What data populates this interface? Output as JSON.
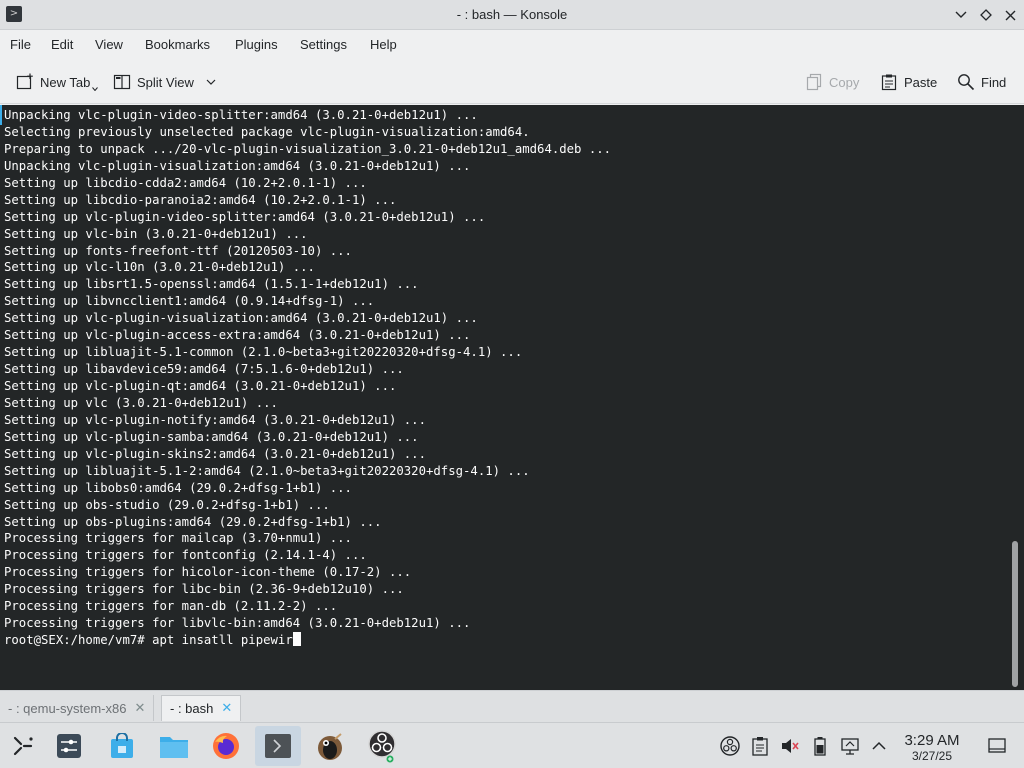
{
  "window": {
    "title": "- : bash — Konsole"
  },
  "menu": {
    "items": [
      "File",
      "Edit",
      "View",
      "Bookmarks",
      "Plugins",
      "Settings",
      "Help"
    ]
  },
  "toolbar": {
    "new_tab": "New Tab",
    "split_view": "Split View",
    "copy": "Copy",
    "paste": "Paste",
    "find": "Find"
  },
  "terminal": {
    "lines": [
      "Unpacking vlc-plugin-video-splitter:amd64 (3.0.21-0+deb12u1) ...",
      "Selecting previously unselected package vlc-plugin-visualization:amd64.",
      "Preparing to unpack .../20-vlc-plugin-visualization_3.0.21-0+deb12u1_amd64.deb ...",
      "Unpacking vlc-plugin-visualization:amd64 (3.0.21-0+deb12u1) ...",
      "Setting up libcdio-cdda2:amd64 (10.2+2.0.1-1) ...",
      "Setting up libcdio-paranoia2:amd64 (10.2+2.0.1-1) ...",
      "Setting up vlc-plugin-video-splitter:amd64 (3.0.21-0+deb12u1) ...",
      "Setting up vlc-bin (3.0.21-0+deb12u1) ...",
      "Setting up fonts-freefont-ttf (20120503-10) ...",
      "Setting up vlc-l10n (3.0.21-0+deb12u1) ...",
      "Setting up libsrt1.5-openssl:amd64 (1.5.1-1+deb12u1) ...",
      "Setting up libvncclient1:amd64 (0.9.14+dfsg-1) ...",
      "Setting up vlc-plugin-visualization:amd64 (3.0.21-0+deb12u1) ...",
      "Setting up vlc-plugin-access-extra:amd64 (3.0.21-0+deb12u1) ...",
      "Setting up libluajit-5.1-common (2.1.0~beta3+git20220320+dfsg-4.1) ...",
      "Setting up libavdevice59:amd64 (7:5.1.6-0+deb12u1) ...",
      "Setting up vlc-plugin-qt:amd64 (3.0.21-0+deb12u1) ...",
      "Setting up vlc (3.0.21-0+deb12u1) ...",
      "Setting up vlc-plugin-notify:amd64 (3.0.21-0+deb12u1) ...",
      "Setting up vlc-plugin-samba:amd64 (3.0.21-0+deb12u1) ...",
      "Setting up vlc-plugin-skins2:amd64 (3.0.21-0+deb12u1) ...",
      "Setting up libluajit-5.1-2:amd64 (2.1.0~beta3+git20220320+dfsg-4.1) ...",
      "Setting up libobs0:amd64 (29.0.2+dfsg-1+b1) ...",
      "Setting up obs-studio (29.0.2+dfsg-1+b1) ...",
      "Setting up obs-plugins:amd64 (29.0.2+dfsg-1+b1) ...",
      "Processing triggers for mailcap (3.70+nmu1) ...",
      "Processing triggers for fontconfig (2.14.1-4) ...",
      "Processing triggers for hicolor-icon-theme (0.17-2) ...",
      "Processing triggers for libc-bin (2.36-9+deb12u10) ...",
      "Processing triggers for man-db (2.11.2-2) ...",
      "Processing triggers for libvlc-bin:amd64 (3.0.21-0+deb12u1) ..."
    ],
    "prompt": "root@SEX:/home/vm7# apt insatll pipewir"
  },
  "tabs": [
    {
      "label": "- : qemu-system-x86",
      "active": false
    },
    {
      "label": "- : bash",
      "active": true
    }
  ],
  "taskbar": {
    "clock_time": "3:29 AM",
    "clock_date": "3/27/25"
  },
  "colors": {
    "terminal_bg": "#232627",
    "terminal_fg": "#fcfcfc",
    "accent": "#3daee9"
  }
}
